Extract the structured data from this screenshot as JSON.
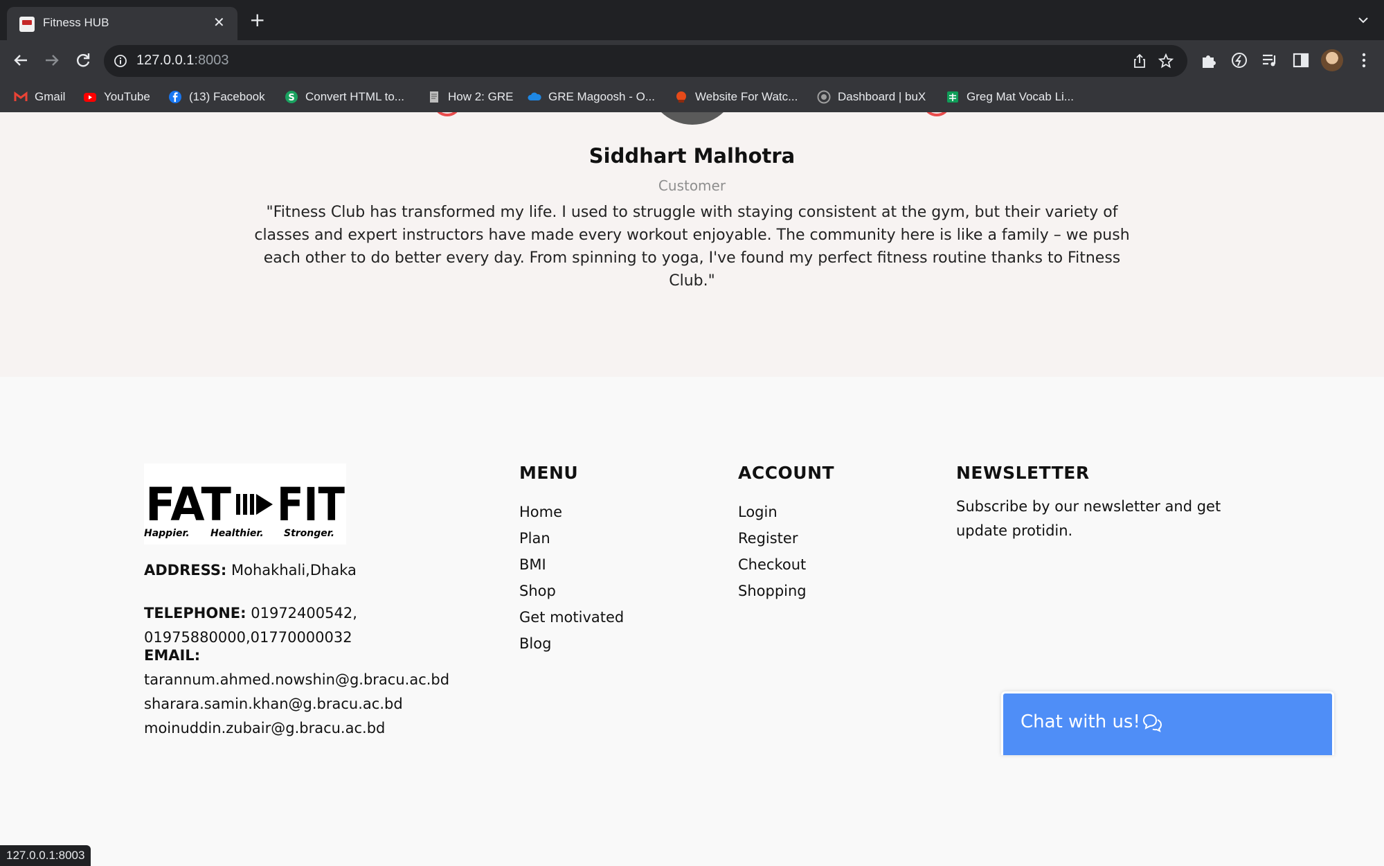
{
  "browser": {
    "tab_title": "Fitness HUB",
    "url_host": "127.0.0.1",
    "url_port": ":8003",
    "status_url": "127.0.0.1:8003",
    "bookmarks": [
      {
        "label": "Gmail",
        "icon": "gmail-icon",
        "color": "#ea4335"
      },
      {
        "label": "YouTube",
        "icon": "youtube-icon",
        "color": "#ff0000"
      },
      {
        "label": "(13) Facebook",
        "icon": "facebook-icon",
        "color": "#1877f2"
      },
      {
        "label": "Convert HTML to...",
        "icon": "convert-icon",
        "color": "#1aa260"
      },
      {
        "label": "How 2: GRE",
        "icon": "page-icon",
        "color": "#bdbdbd"
      },
      {
        "label": "GRE Magoosh - O...",
        "icon": "cloud-icon",
        "color": "#1e88e5"
      },
      {
        "label": "Website For Watc...",
        "icon": "website-icon",
        "color": "#e64a19"
      },
      {
        "label": "Dashboard | buX",
        "icon": "dashboard-icon",
        "color": "#9e9e9e"
      },
      {
        "label": "Greg Mat Vocab Li...",
        "icon": "sheets-icon",
        "color": "#0f9d58"
      }
    ]
  },
  "testimonial": {
    "name": "Siddhart Malhotra",
    "role": "Customer",
    "quote": "\"Fitness Club has transformed my life. I used to struggle with staying consistent at the gym, but their variety of classes and expert instructors have made every workout enjoyable. The community here is like a family – we push each other to do better every day. From spinning to yoga, I've found my perfect fitness routine thanks to Fitness Club.\""
  },
  "footer": {
    "logo": {
      "word_left": "FAT",
      "word_right": "FIT",
      "tagline_1": "Happier.",
      "tagline_2": "Healthier.",
      "tagline_3": "Stronger."
    },
    "address_label": "ADDRESS:",
    "address_value": "Mohakhali,Dhaka",
    "telephone_label": "TELEPHONE:",
    "telephone_line1": "01972400542,",
    "telephone_line2": "01975880000,01770000032",
    "email_label": "EMAIL:",
    "emails": [
      "tarannum.ahmed.nowshin@g.bracu.ac.bd",
      "sharara.samin.khan@g.bracu.ac.bd",
      "moinuddin.zubair@g.bracu.ac.bd"
    ],
    "menu": {
      "title": "MENU",
      "items": [
        "Home",
        "Plan",
        "BMI",
        "Shop",
        "Get motivated",
        "Blog"
      ]
    },
    "account": {
      "title": "ACCOUNT",
      "items": [
        "Login",
        "Register",
        "Checkout",
        "Shopping"
      ]
    },
    "newsletter": {
      "title": "NEWSLETTER",
      "text": "Subscribe by our newsletter and get update protidin."
    }
  },
  "chat": {
    "label": "Chat with us!",
    "icon": "chat-bubbles-icon",
    "color": "#4f8ef7"
  }
}
